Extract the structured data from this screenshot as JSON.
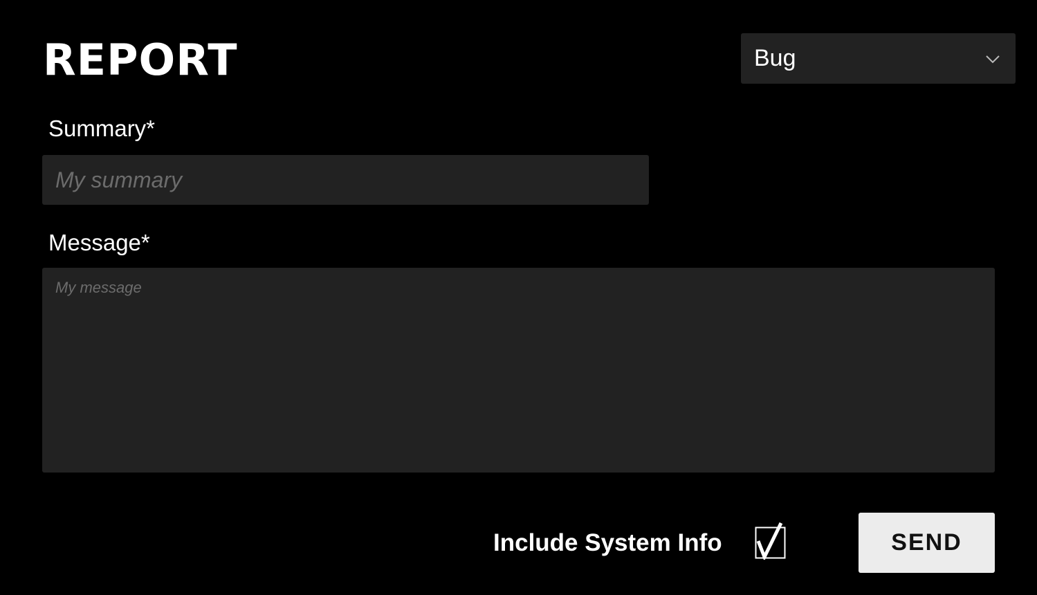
{
  "header": {
    "title": "REPORT"
  },
  "report_type": {
    "selected": "Bug",
    "icon": "chevron-down-icon"
  },
  "summary": {
    "label": "Summary*",
    "placeholder": "My summary",
    "value": ""
  },
  "message": {
    "label": "Message*",
    "placeholder": "My message",
    "value": ""
  },
  "system_info": {
    "label": "Include System Info",
    "checked": true,
    "icon": "checkmark-icon"
  },
  "actions": {
    "send_label": "SEND"
  },
  "colors": {
    "background": "#000000",
    "field": "#222222",
    "text": "#ffffff",
    "placeholder": "#6c6c6c",
    "button": "#ececec",
    "button_text": "#111111"
  }
}
